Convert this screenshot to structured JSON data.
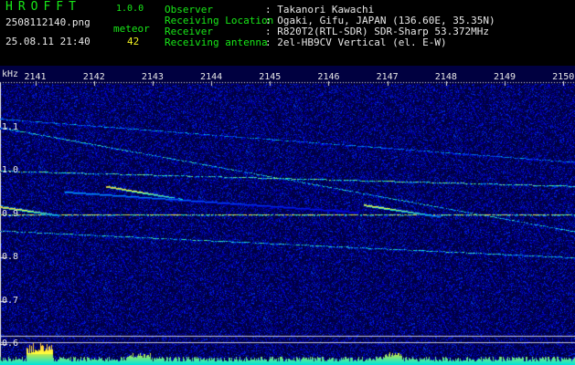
{
  "app": {
    "title": "HROFFT",
    "version": "1.0.0"
  },
  "file": {
    "name": "2508112140.png",
    "datetime": "25.08.11 21:40"
  },
  "meteor": {
    "label": "meteor",
    "count": "42"
  },
  "info": [
    {
      "label": "Observer",
      "value": ": Takanori Kawachi"
    },
    {
      "label": "Receiving Location",
      "value": ": Ogaki, Gifu, JAPAN (136.60E, 35.35N)"
    },
    {
      "label": "Receiver",
      "value": ": R820T2(RTL-SDR) SDR-Sharp 53.372MHz"
    },
    {
      "label": "Receiving antenna",
      "value": ": 2el-HB9CV Vertical (el. E-W)"
    }
  ],
  "colors": {
    "header_text": "#18e818",
    "info_text": "#e8e8e8",
    "count_text": "#f0f020",
    "background": "#000000",
    "spectrogram_bg": "#000040"
  },
  "chart_data": {
    "type": "heatmap",
    "unit_label": "kHz",
    "x_ticks": [
      "2141",
      "2142",
      "2143",
      "2144",
      "2145",
      "2146",
      "2147",
      "2148",
      "2149",
      "2150"
    ],
    "x_range": [
      2140.4,
      2150.2
    ],
    "y_ticks": [
      "1.1",
      "1.0",
      "0.9",
      "0.8",
      "0.7",
      "0.6"
    ],
    "y_range": [
      0.59,
      1.2
    ],
    "carriers": [
      {
        "f_start": 1.12,
        "f_end": 1.02,
        "t_start": 2140.4,
        "t_end": 2150.2,
        "intensity": 0.5
      },
      {
        "f_start": 1.1,
        "f_end": 0.86,
        "t_start": 2140.4,
        "t_end": 2150.2,
        "intensity": 0.6
      },
      {
        "f_start": 1.0,
        "f_end": 0.965,
        "t_start": 2140.4,
        "t_end": 2150.2,
        "intensity": 0.7
      },
      {
        "f_start": 0.9,
        "f_end": 0.9,
        "t_start": 2140.4,
        "t_end": 2150.2,
        "intensity": 0.9
      },
      {
        "f_start": 0.862,
        "f_end": 0.8,
        "t_start": 2140.4,
        "t_end": 2150.2,
        "intensity": 0.6
      }
    ],
    "meteor_echoes": [
      {
        "t_start": 2140.4,
        "t_end": 2141.4,
        "f_start": 0.918,
        "f_end": 0.898,
        "intensity": 1.0
      },
      {
        "t_start": 2142.2,
        "t_end": 2143.5,
        "f_start": 0.965,
        "f_end": 0.935,
        "intensity": 1.0
      },
      {
        "t_start": 2146.6,
        "t_end": 2147.9,
        "f_start": 0.922,
        "f_end": 0.895,
        "intensity": 0.9
      },
      {
        "t_start": 2141.5,
        "t_end": 2146.5,
        "f_start": 0.952,
        "f_end": 0.905,
        "intensity": 0.5
      }
    ],
    "baseline_levels": [
      0.62,
      0.605
    ]
  }
}
